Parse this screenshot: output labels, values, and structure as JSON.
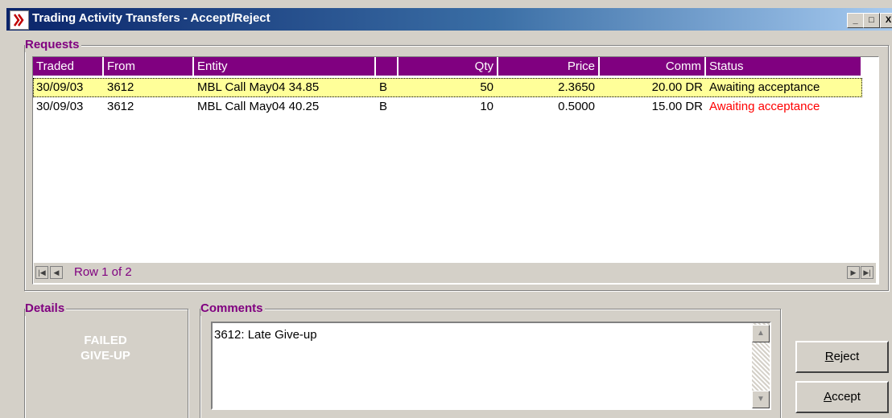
{
  "window": {
    "title": "Trading Activity Transfers - Accept/Reject",
    "minimize": "_",
    "maximize": "□",
    "close": "X"
  },
  "requests": {
    "label": "Requests",
    "columns": {
      "traded": "Traded",
      "from": "From",
      "entity": "Entity",
      "side": "",
      "qty": "Qty",
      "price": "Price",
      "comm": "Comm",
      "status": "Status"
    },
    "rows": [
      {
        "traded": "30/09/03",
        "from": "3612",
        "entity": "MBL Call May04 34.85",
        "side": "B",
        "qty": "50",
        "price": "2.3650",
        "comm": "20.00 DR",
        "status": "Awaiting acceptance",
        "status_color": "#000000",
        "selected": true
      },
      {
        "traded": "30/09/03",
        "from": "3612",
        "entity": "MBL Call May04 40.25",
        "side": "B",
        "qty": "10",
        "price": "0.5000",
        "comm": "15.00 DR",
        "status": "Awaiting acceptance",
        "status_color": "#ff0000",
        "selected": false
      }
    ],
    "navigator": {
      "row_text": "Row 1 of 2"
    }
  },
  "details": {
    "label": "Details",
    "line1": "FAILED",
    "line2": "GIVE-UP"
  },
  "comments": {
    "label": "Comments",
    "text": "3612: Late Give-up"
  },
  "buttons": {
    "reject_first": "R",
    "reject_rest": "eject",
    "accept_first": "A",
    "accept_rest": "ccept"
  },
  "colors": {
    "header": "#800080",
    "selected_row": "#ffff99",
    "title_bar": "#0a246a"
  }
}
